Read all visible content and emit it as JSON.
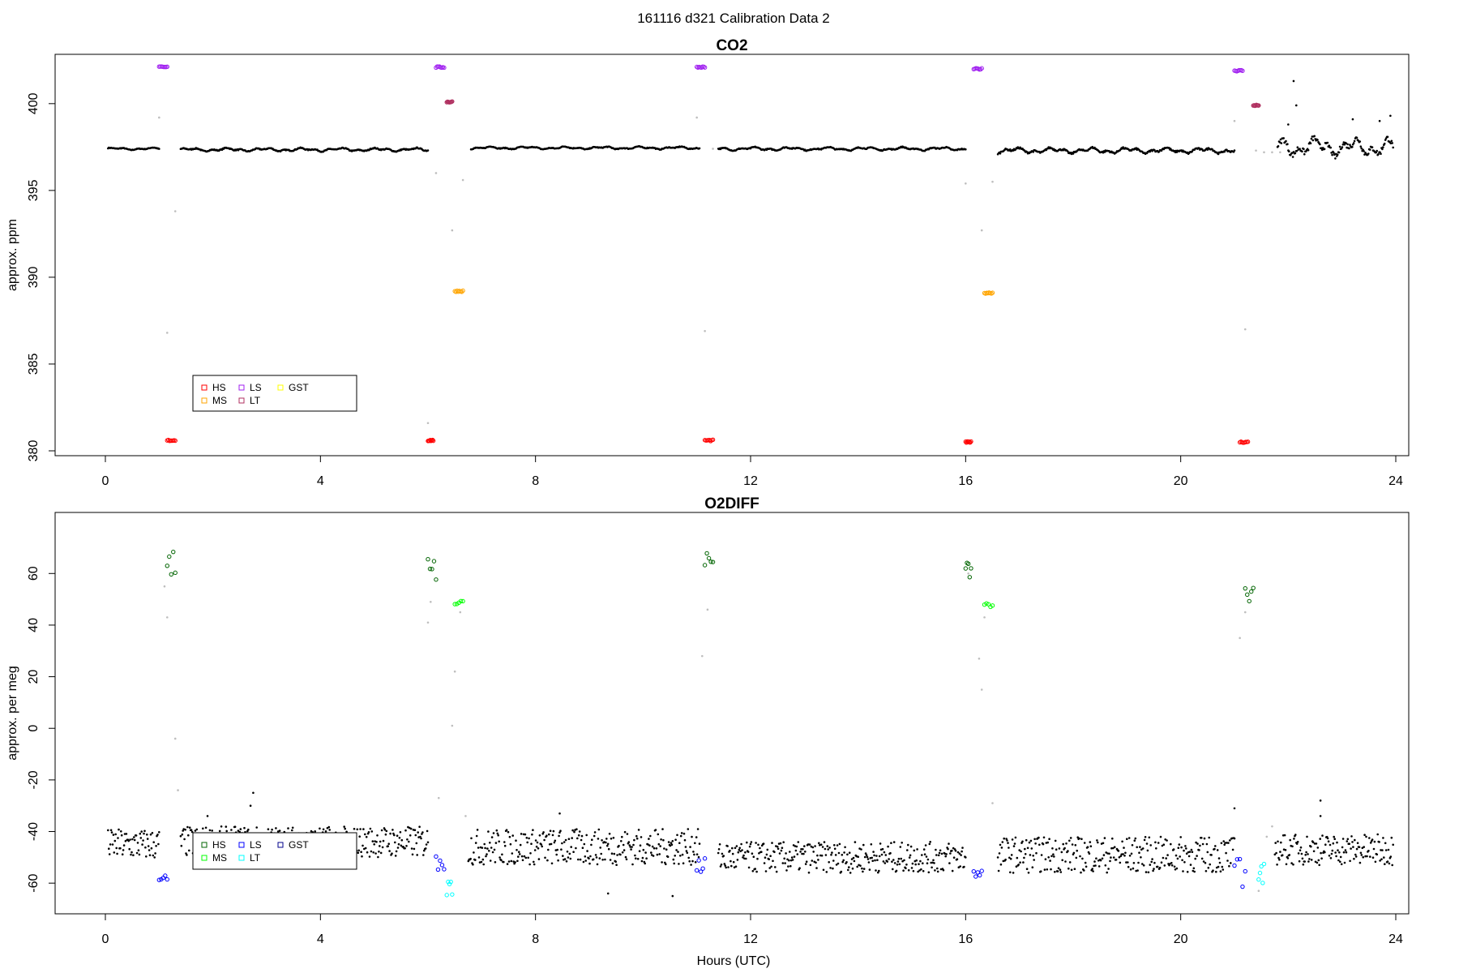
{
  "page_title": "161116   d321   Calibration Data 2",
  "x_axis_label": "Hours (UTC)",
  "chart_data": [
    {
      "type": "scatter",
      "title": "CO2",
      "ylabel": "approx. ppm",
      "xlim": [
        0,
        24
      ],
      "ylim": [
        380,
        402
      ],
      "xticks": [
        0,
        4,
        8,
        12,
        16,
        20,
        24
      ],
      "yticks": [
        380,
        385,
        390,
        395,
        400
      ],
      "legend": {
        "placement": "bottom-left",
        "entries": [
          {
            "label": "HS",
            "color": "#ff0000"
          },
          {
            "label": "MS",
            "color": "#ffa500"
          },
          {
            "label": "LS",
            "color": "#a020f0"
          },
          {
            "label": "LT",
            "color": "#b03060"
          },
          {
            "label": "GST",
            "color": "#ffff00"
          }
        ]
      },
      "colors": {
        "ambient": "#000000",
        "excluded": "#bebebe",
        "HS": "#ff0000",
        "MS": "#ffa500",
        "LS": "#a020f0",
        "LT": "#b03060"
      },
      "ambient_segments": [
        {
          "x0": 0.05,
          "x1": 1.0,
          "base": 397.4,
          "amp": 0.1
        },
        {
          "x0": 1.4,
          "x1": 6.0,
          "base": 397.35,
          "amp": 0.15
        },
        {
          "x0": 6.8,
          "x1": 11.05,
          "base": 397.45,
          "amp": 0.12
        },
        {
          "x0": 11.4,
          "x1": 16.0,
          "base": 397.4,
          "amp": 0.15
        },
        {
          "x0": 16.6,
          "x1": 21.0,
          "base": 397.3,
          "amp": 0.25
        },
        {
          "x0": 21.8,
          "x1": 23.95,
          "base": 397.5,
          "amp": 0.8
        }
      ],
      "excluded_points": [
        {
          "x": 1.0,
          "y": 399.2
        },
        {
          "x": 1.15,
          "y": 386.8
        },
        {
          "x": 1.3,
          "y": 393.8
        },
        {
          "x": 6.0,
          "y": 381.6
        },
        {
          "x": 6.15,
          "y": 396.0
        },
        {
          "x": 6.35,
          "y": 400.1
        },
        {
          "x": 6.45,
          "y": 392.7
        },
        {
          "x": 6.65,
          "y": 395.6
        },
        {
          "x": 11.0,
          "y": 399.2
        },
        {
          "x": 11.15,
          "y": 386.9
        },
        {
          "x": 11.3,
          "y": 397.4
        },
        {
          "x": 16.0,
          "y": 395.4
        },
        {
          "x": 16.3,
          "y": 392.7
        },
        {
          "x": 16.5,
          "y": 395.5
        },
        {
          "x": 21.0,
          "y": 399.0
        },
        {
          "x": 21.2,
          "y": 387.0
        },
        {
          "x": 21.4,
          "y": 397.3
        },
        {
          "x": 21.55,
          "y": 397.2
        },
        {
          "x": 21.7,
          "y": 397.2
        },
        {
          "x": 21.85,
          "y": 397.2
        }
      ],
      "cal_runs": [
        {
          "gas": "LS",
          "x0": 1.0,
          "x1": 1.15,
          "y": 402.1
        },
        {
          "gas": "HS",
          "x0": 1.15,
          "x1": 1.3,
          "y": 380.6
        },
        {
          "gas": "HS",
          "x0": 6.0,
          "x1": 6.1,
          "y": 380.6
        },
        {
          "gas": "LS",
          "x0": 6.15,
          "x1": 6.3,
          "y": 402.1
        },
        {
          "gas": "LT",
          "x0": 6.35,
          "x1": 6.45,
          "y": 400.1
        },
        {
          "gas": "MS",
          "x0": 6.5,
          "x1": 6.65,
          "y": 389.2
        },
        {
          "gas": "LS",
          "x0": 11.0,
          "x1": 11.15,
          "y": 402.1
        },
        {
          "gas": "HS",
          "x0": 11.15,
          "x1": 11.3,
          "y": 380.6
        },
        {
          "gas": "HS",
          "x0": 16.0,
          "x1": 16.1,
          "y": 380.5
        },
        {
          "gas": "LS",
          "x0": 16.15,
          "x1": 16.3,
          "y": 402.0
        },
        {
          "gas": "MS",
          "x0": 16.35,
          "x1": 16.5,
          "y": 389.1
        },
        {
          "gas": "LS",
          "x0": 21.0,
          "x1": 21.15,
          "y": 401.9
        },
        {
          "gas": "HS",
          "x0": 21.1,
          "x1": 21.25,
          "y": 380.5
        },
        {
          "gas": "LT",
          "x0": 21.35,
          "x1": 21.45,
          "y": 399.9
        }
      ],
      "outlier_points": [
        {
          "x": 22.1,
          "y": 401.3
        },
        {
          "x": 22.15,
          "y": 399.9
        },
        {
          "x": 22.0,
          "y": 398.8
        },
        {
          "x": 23.2,
          "y": 399.1
        },
        {
          "x": 23.7,
          "y": 399.0
        },
        {
          "x": 23.9,
          "y": 399.3
        }
      ]
    },
    {
      "type": "scatter",
      "title": "O2DIFF",
      "ylabel": "approx. per meg",
      "xlim": [
        0,
        24
      ],
      "ylim": [
        -70,
        78
      ],
      "xticks": [
        0,
        4,
        8,
        12,
        16,
        20,
        24
      ],
      "yticks": [
        -60,
        -40,
        -20,
        0,
        20,
        40,
        60
      ],
      "legend": {
        "placement": "bottom-left",
        "entries": [
          {
            "label": "HS",
            "color": "#006400"
          },
          {
            "label": "MS",
            "color": "#00ff00"
          },
          {
            "label": "LS",
            "color": "#0000ff"
          },
          {
            "label": "LT",
            "color": "#00ffff"
          },
          {
            "label": "GST",
            "color": "#00008b"
          }
        ]
      },
      "colors": {
        "ambient": "#000000",
        "excluded": "#bebebe",
        "HS": "#006400",
        "MS": "#00ff00",
        "LS": "#0000ff",
        "LT": "#00ffff"
      },
      "ambient_segments": [
        {
          "x0": 0.05,
          "x1": 1.0,
          "base": -45,
          "amp": 6
        },
        {
          "x0": 1.4,
          "x1": 6.0,
          "base": -44,
          "amp": 6
        },
        {
          "x0": 6.75,
          "x1": 11.05,
          "base": -46,
          "amp": 7
        },
        {
          "x0": 11.4,
          "x1": 16.0,
          "base": -50,
          "amp": 6
        },
        {
          "x0": 16.6,
          "x1": 21.0,
          "base": -49,
          "amp": 7
        },
        {
          "x0": 21.75,
          "x1": 23.95,
          "base": -47,
          "amp": 6
        }
      ],
      "excluded_points": [
        {
          "x": 1.1,
          "y": 55
        },
        {
          "x": 1.15,
          "y": 43
        },
        {
          "x": 1.3,
          "y": -4
        },
        {
          "x": 1.35,
          "y": -24
        },
        {
          "x": 6.0,
          "y": 41
        },
        {
          "x": 6.05,
          "y": 49
        },
        {
          "x": 6.2,
          "y": -27
        },
        {
          "x": 6.45,
          "y": 1
        },
        {
          "x": 6.5,
          "y": 22
        },
        {
          "x": 6.6,
          "y": 45
        },
        {
          "x": 6.7,
          "y": -34
        },
        {
          "x": 11.1,
          "y": 28
        },
        {
          "x": 11.2,
          "y": 46
        },
        {
          "x": 16.05,
          "y": 60
        },
        {
          "x": 16.25,
          "y": 27
        },
        {
          "x": 16.3,
          "y": 15
        },
        {
          "x": 16.35,
          "y": 43
        },
        {
          "x": 16.5,
          "y": -29
        },
        {
          "x": 21.1,
          "y": 35
        },
        {
          "x": 21.2,
          "y": 45
        },
        {
          "x": 21.45,
          "y": -63
        },
        {
          "x": 21.6,
          "y": -42
        },
        {
          "x": 21.7,
          "y": -38
        }
      ],
      "cal_runs": [
        {
          "gas": "LS",
          "x0": 1.0,
          "x1": 1.15,
          "y": -56,
          "spread": 3
        },
        {
          "gas": "HS",
          "x0": 1.15,
          "x1": 1.3,
          "y": 64,
          "spread": 6
        },
        {
          "gas": "HS",
          "x0": 6.0,
          "x1": 6.15,
          "y": 62,
          "spread": 5
        },
        {
          "gas": "LS",
          "x0": 6.15,
          "x1": 6.3,
          "y": -52,
          "spread": 3
        },
        {
          "gas": "LT",
          "x0": 6.35,
          "x1": 6.45,
          "y": -62,
          "spread": 3
        },
        {
          "gas": "MS",
          "x0": 6.5,
          "x1": 6.65,
          "y": 49,
          "spread": 1
        },
        {
          "gas": "LS",
          "x0": 11.0,
          "x1": 11.15,
          "y": -54,
          "spread": 4
        },
        {
          "gas": "HS",
          "x0": 11.15,
          "x1": 11.3,
          "y": 65,
          "spread": 3
        },
        {
          "gas": "HS",
          "x0": 16.0,
          "x1": 16.1,
          "y": 61,
          "spread": 4
        },
        {
          "gas": "LS",
          "x0": 16.15,
          "x1": 16.3,
          "y": -57,
          "spread": 2
        },
        {
          "gas": "MS",
          "x0": 16.35,
          "x1": 16.5,
          "y": 48,
          "spread": 1
        },
        {
          "gas": "LS",
          "x0": 21.0,
          "x1": 21.2,
          "y": -55,
          "spread": 8
        },
        {
          "gas": "HS",
          "x0": 21.2,
          "x1": 21.35,
          "y": 52,
          "spread": 3
        },
        {
          "gas": "LT",
          "x0": 21.45,
          "x1": 21.55,
          "y": -56,
          "spread": 4
        }
      ],
      "outlier_points": [
        {
          "x": 2.75,
          "y": -25
        },
        {
          "x": 2.7,
          "y": -30
        },
        {
          "x": 1.9,
          "y": -34
        },
        {
          "x": 8.45,
          "y": -33
        },
        {
          "x": 9.35,
          "y": -64
        },
        {
          "x": 10.55,
          "y": -65
        },
        {
          "x": 21.0,
          "y": -31
        },
        {
          "x": 22.6,
          "y": -28
        },
        {
          "x": 22.6,
          "y": -34
        }
      ]
    }
  ]
}
